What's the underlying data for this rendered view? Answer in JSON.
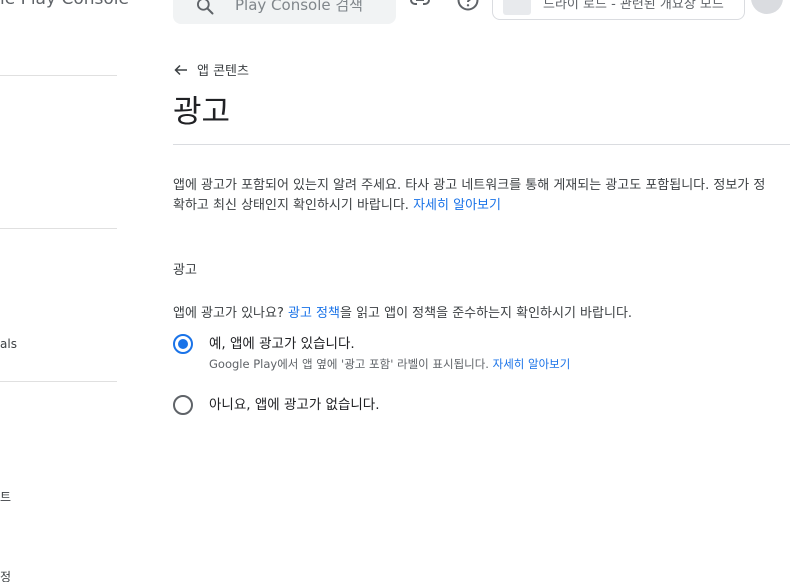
{
  "header": {
    "logo_text": "le Play Console",
    "search_placeholder": "Play Console 검색",
    "account_name": "드라이 로드 - 관련된 개요장 모드"
  },
  "sidebar": {
    "fragments": [
      "als",
      "트",
      "정"
    ]
  },
  "page": {
    "back_label": "앱 콘텐츠",
    "title": "광고",
    "description": "앱에 광고가 포함되어 있는지 알려 주세요. 타사 광고 네트워크를 통해 게재되는 광고도 포함됩니다. 정보가 정확하고 최신 상태인지 확인하시기 바랍니다.",
    "learn_more": "자세히 알아보기",
    "section_label": "광고",
    "question_prefix": "앱에 광고가 있나요?",
    "question_link": "광고 정책",
    "question_suffix": "을 읽고 앱이 정책을 준수하는지 확인하시기 바랍니다.",
    "options": [
      {
        "label": "예, 앱에 광고가 있습니다.",
        "sub": "Google Play에서 앱 옆에 '광고 포함' 라벨이 표시됩니다.",
        "sub_link": "자세히 알아보기",
        "selected": true
      },
      {
        "label": "아니요, 앱에 광고가 없습니다.",
        "selected": false
      }
    ]
  },
  "colors": {
    "accent": "#1a73e8",
    "text": "#202124",
    "muted": "#5f6368"
  }
}
